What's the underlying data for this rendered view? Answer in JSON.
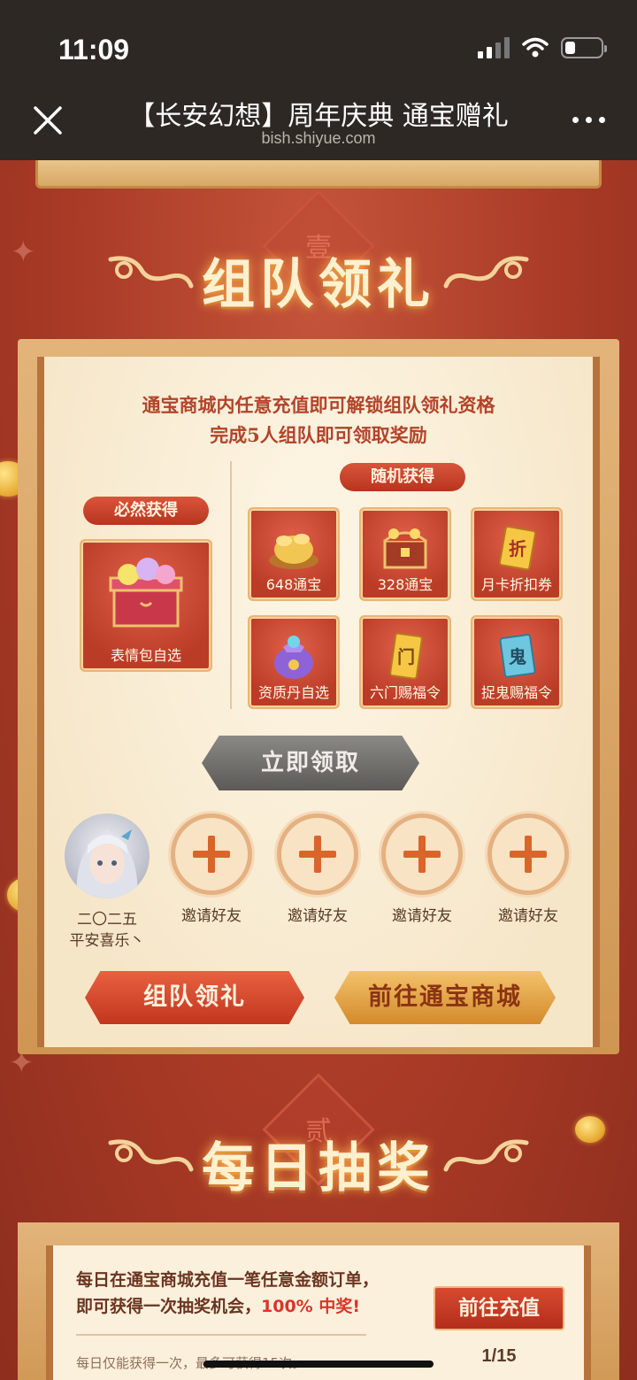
{
  "status_bar": {
    "time": "11:09"
  },
  "nav": {
    "title": "【长安幻想】周年庆典 通宝赠礼",
    "url": "bish.shiyue.com"
  },
  "section1": {
    "seal_char": "壹",
    "title": "组队领礼",
    "intro_line1": "通宝商城内任意充值即可解锁组队领礼资格",
    "intro_line2": "完成5人组队即可领取奖励",
    "guaranteed_label": "必然获得",
    "random_label": "随机获得",
    "guaranteed_reward": "表情包自选",
    "random_rewards": [
      {
        "label": "648通宝",
        "icon": "gold-ingot-pile-icon"
      },
      {
        "label": "328通宝",
        "icon": "treasure-chest-icon"
      },
      {
        "label": "月卡折扣券",
        "icon": "discount-coupon-icon"
      },
      {
        "label": "资质丹自选",
        "icon": "pouch-icon"
      },
      {
        "label": "六门赐福令",
        "icon": "gold-token-icon"
      },
      {
        "label": "捉鬼赐福令",
        "icon": "ghost-token-icon"
      }
    ],
    "token_chars": {
      "coupon": "折",
      "gate": "门",
      "ghost": "鬼"
    },
    "claim_button": "立即领取",
    "team": [
      {
        "label_line1": "二〇二五",
        "label_line2": "平安喜乐丶",
        "filled": true
      },
      {
        "label_line1": "邀请好友",
        "filled": false
      },
      {
        "label_line1": "邀请好友",
        "filled": false
      },
      {
        "label_line1": "邀请好友",
        "filled": false
      },
      {
        "label_line1": "邀请好友",
        "filled": false
      }
    ],
    "team_button": "组队领礼",
    "shop_button": "前往通宝商城"
  },
  "section2": {
    "seal_char": "贰",
    "title": "每日抽奖",
    "line1": "每日在通宝商城充值一笔任意金额订单，",
    "line2_prefix": "即可获得一次抽奖机会，",
    "line2_highlight": "100% 中奖!",
    "note": "每日仅能获得一次，最多可获得15次。",
    "recharge_button": "前往充值",
    "pager": "1/15"
  },
  "colors": {
    "background": "#a93a26",
    "panel": "#fbf0dc",
    "accent_red": "#d8362a",
    "gold": "#f3c26a"
  }
}
